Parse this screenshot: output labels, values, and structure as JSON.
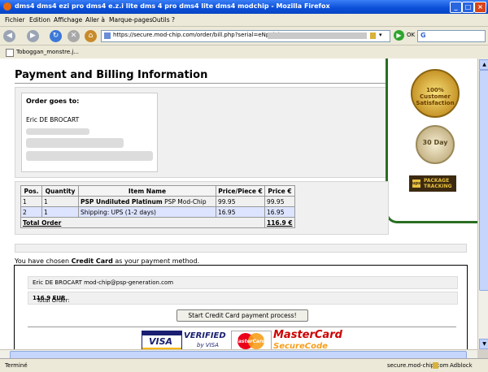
{
  "window": {
    "title": "dms4 dms4 ezi pro dms4 e.z.i lite dms 4 pro dms4 lite dms4 modchip - Mozilla Firefox",
    "controls": {
      "minimize": "_",
      "maximize": "□",
      "close": "×"
    }
  },
  "menu": [
    "Fichier",
    "Edition",
    "Affichage",
    "Aller à",
    "Marque-pages",
    "Outils",
    "?"
  ],
  "nav": {
    "back": "◀",
    "forward": "▶",
    "reload": "↻",
    "stop": "✕",
    "home": "⌂",
    "url": "https://secure.mod-chip.com/order/bill.php?serial=eNpFkd1ur",
    "go_symbol": "▶",
    "go_label": "OK",
    "search_engine": "G"
  },
  "bookmarks": [
    "Toboggan_monstre.j..."
  ],
  "page": {
    "title": "Payment and Billing Information",
    "shipping": {
      "label": "Order goes to:",
      "name": "Eric DE BROCART"
    },
    "badges": {
      "guarantee": "100% Customer Satisfaction",
      "money_back": "30 Day",
      "ups": {
        "mark": "ups",
        "label_line1": "PACKAGE",
        "label_line2": "TRACKING"
      }
    },
    "order_table": {
      "headers": [
        "Pos.",
        "Quantity",
        "Item Name",
        "Price/Piece €",
        "Price €"
      ],
      "rows": [
        {
          "pos": "1",
          "qty": "1",
          "item_bold": "PSP Undiluted Platinum",
          "item_rest": " PSP Mod-Chip",
          "price_piece": "99.95",
          "price": "99.95"
        },
        {
          "pos": "2",
          "qty": "1",
          "item_bold": "",
          "item_rest": "Shipping: UPS (1-2 days)",
          "price_piece": "16.95",
          "price": "16.95"
        }
      ],
      "total_label": "Total Order",
      "total_value": "116.9 €"
    },
    "payment": {
      "prefix": "You have chosen ",
      "method": "Credit Card",
      "suffix": " as your payment method.",
      "contact": "Eric DE BROCART mod-chip@psp-generation.com",
      "total_prefix": "Total Order: ",
      "total_value": "116.9 EUR",
      "start_button": "Start Credit Card payment process!"
    },
    "card_logos": {
      "visa": "VISA",
      "verified_line1": "VERIFIED",
      "verified_line2": "by VISA",
      "mastercard": "MasterCard",
      "mastercard_title": "MasterCard",
      "securecode": "SecureCode"
    }
  },
  "status": {
    "text": "Terminé",
    "domain": "secure.mod-chip.com",
    "adblock": "Adblock"
  }
}
